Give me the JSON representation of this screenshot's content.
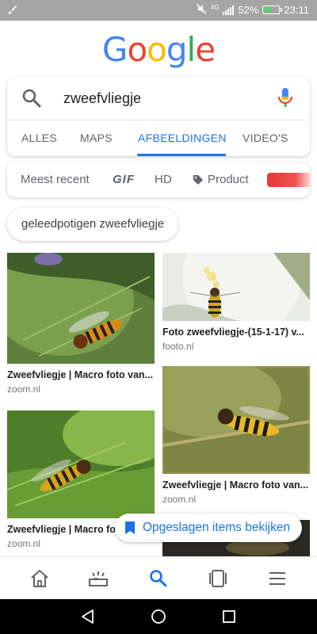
{
  "status": {
    "battery": "52%",
    "time": "23:11",
    "network": "4G",
    "battery_level": 0.52
  },
  "logo": {
    "text": "Google",
    "letters": [
      "G",
      "o",
      "o",
      "g",
      "l",
      "e"
    ],
    "colors": [
      "#4285F4",
      "#EA4335",
      "#FBBC05",
      "#4285F4",
      "#34A853",
      "#EA4335"
    ]
  },
  "search": {
    "query": "zweefvliegje"
  },
  "tabs": [
    {
      "label": "ALLES",
      "active": false
    },
    {
      "label": "MAPS",
      "active": false
    },
    {
      "label": "AFBEELDINGEN",
      "active": true
    },
    {
      "label": "VIDEO'S",
      "active": false
    }
  ],
  "filters": {
    "recent": "Meest recent",
    "gif": "GIF",
    "hd": "HD",
    "product": "Product"
  },
  "suggestion": "geleedpotigen zweefvliegje",
  "results": [
    {
      "caption": "Zweefvliegje | Macro foto van...",
      "source": "zoom.nl"
    },
    {
      "caption": "Foto zweefvliegje-(15-1-17) v...",
      "source": "footo.nl"
    },
    {
      "caption": "Zweefvliegje | Macro foto van...",
      "source": "zoom.nl"
    },
    {
      "caption": "Zweefvliegje | Macro foto van...",
      "source": "zoom.nl"
    }
  ],
  "saved_pill": {
    "label": "Opgeslagen items bekijken"
  },
  "colors": {
    "accent": "#1a73e8",
    "statusbar": "#a5a5a5"
  }
}
